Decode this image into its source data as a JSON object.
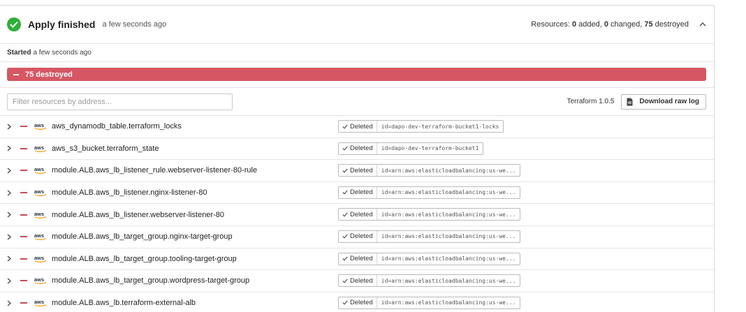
{
  "header": {
    "title": "Apply finished",
    "time": "a few seconds ago",
    "summary_prefix": "Resources: ",
    "added": "0",
    "added_label": " added, ",
    "changed": "0",
    "changed_label": " changed, ",
    "destroyed": "75",
    "destroyed_label": " destroyed"
  },
  "started": {
    "label": "Started",
    "value": "a few seconds ago"
  },
  "bar": {
    "label": "75 destroyed",
    "color": "#d55763"
  },
  "toolbar": {
    "filter_placeholder": "Filter resources by address...",
    "version": "Terraform 1.0.5",
    "download_label": "Download raw log"
  },
  "resources": [
    {
      "address": "aws_dynamodb_table.terraform_locks",
      "status": "Deleted",
      "id": "id=dapo-dev-terraform-bucket1-locks"
    },
    {
      "address": "aws_s3_bucket.terraform_state",
      "status": "Deleted",
      "id": "id=dapo-dev-terraform-bucket1"
    },
    {
      "address": "module.ALB.aws_lb_listener_rule.webserver-listener-80-rule",
      "status": "Deleted",
      "id": "id=arn:aws:elasticloadbalancing:us-we..."
    },
    {
      "address": "module.ALB.aws_lb_listener.nginx-listener-80",
      "status": "Deleted",
      "id": "id=arn:aws:elasticloadbalancing:us-we..."
    },
    {
      "address": "module.ALB.aws_lb_listener.webserver-listener-80",
      "status": "Deleted",
      "id": "id=arn:aws:elasticloadbalancing:us-we..."
    },
    {
      "address": "module.ALB.aws_lb_target_group.nginx-target-group",
      "status": "Deleted",
      "id": "id=arn:aws:elasticloadbalancing:us-we..."
    },
    {
      "address": "module.ALB.aws_lb_target_group.tooling-target-group",
      "status": "Deleted",
      "id": "id=arn:aws:elasticloadbalancing:us-we..."
    },
    {
      "address": "module.ALB.aws_lb_target_group.wordpress-target-group",
      "status": "Deleted",
      "id": "id=arn:aws:elasticloadbalancing:us-we..."
    },
    {
      "address": "module.ALB.aws_lb.terraform-external-alb",
      "status": "Deleted",
      "id": "id=arn:aws:elasticloadbalancing:us-we..."
    }
  ]
}
